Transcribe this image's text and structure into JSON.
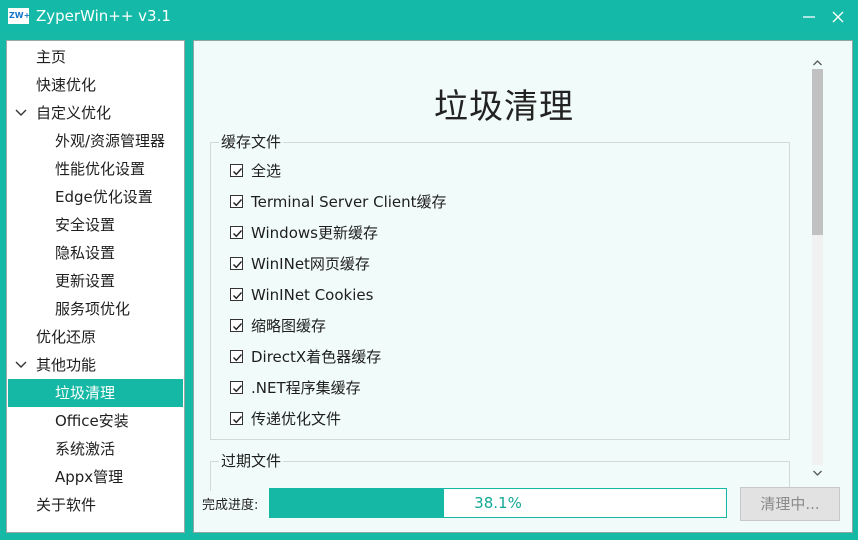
{
  "window": {
    "icon_text": "ZW+",
    "title": "ZyperWin++ v3.1",
    "minimize_glyph": "—",
    "close_glyph": "✕"
  },
  "sidebar": {
    "items": [
      {
        "label": "主页",
        "level": 0
      },
      {
        "label": "快速优化",
        "level": 0
      },
      {
        "label": "自定义优化",
        "level": 0,
        "expanded": true
      },
      {
        "label": "外观/资源管理器",
        "level": 1
      },
      {
        "label": "性能优化设置",
        "level": 1
      },
      {
        "label": "Edge优化设置",
        "level": 1
      },
      {
        "label": "安全设置",
        "level": 1
      },
      {
        "label": "隐私设置",
        "level": 1
      },
      {
        "label": "更新设置",
        "level": 1
      },
      {
        "label": "服务项优化",
        "level": 1
      },
      {
        "label": "优化还原",
        "level": 0
      },
      {
        "label": "其他功能",
        "level": 0,
        "expanded": true
      },
      {
        "label": "垃圾清理",
        "level": 1,
        "selected": true
      },
      {
        "label": "Office安装",
        "level": 1
      },
      {
        "label": "系统激活",
        "level": 1
      },
      {
        "label": "Appx管理",
        "level": 1
      },
      {
        "label": "关于软件",
        "level": 0
      }
    ]
  },
  "main": {
    "title": "垃圾清理",
    "cache_group": {
      "title": "缓存文件",
      "items": [
        {
          "label": "全选",
          "checked": true
        },
        {
          "label": "Terminal Server Client缓存",
          "checked": true
        },
        {
          "label": "Windows更新缓存",
          "checked": true
        },
        {
          "label": "WinINet网页缓存",
          "checked": true
        },
        {
          "label": "WinINet Cookies",
          "checked": true
        },
        {
          "label": "缩略图缓存",
          "checked": true
        },
        {
          "label": "DirectX着色器缓存",
          "checked": true
        },
        {
          "label": ".NET程序集缓存",
          "checked": true
        },
        {
          "label": "传递优化文件",
          "checked": true
        }
      ]
    },
    "expired_group": {
      "title": "过期文件"
    },
    "scrollbar": {
      "position_fraction": 0.0,
      "visible_fraction": 0.42
    }
  },
  "footer": {
    "progress_label": "完成进度:",
    "progress_percent": 38.1,
    "progress_text": "38.1%",
    "action_label": "清理中..."
  },
  "colors": {
    "accent": "#14b8a5",
    "panel_bg": "#f1fcfa",
    "text": "#1e1e1e"
  }
}
